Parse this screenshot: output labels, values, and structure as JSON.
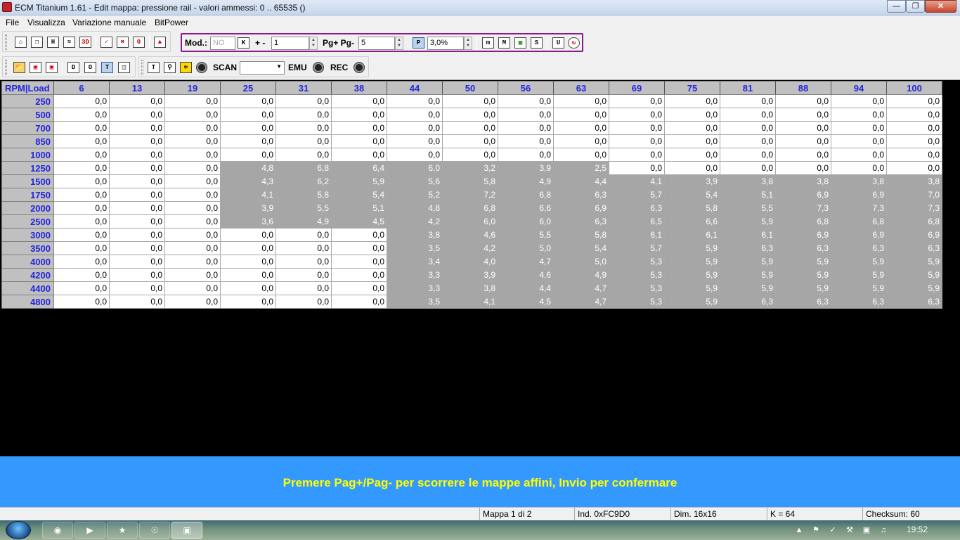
{
  "window": {
    "title": "ECM Titanium 1.61 - Edit mappa: pressione rail - valori ammessi: 0 .. 65535 ()"
  },
  "menu": [
    "File",
    "Visualizza",
    "Variazione manuale",
    "BitPower"
  ],
  "toolbar": {
    "mod_label": "Mod.:",
    "mod_value": "NO",
    "k_button": "K",
    "plusminus_label": "+ -",
    "step_value": "1",
    "pg_label": "Pg+ Pg-",
    "pg_value": "5",
    "p_button": "P",
    "percent_value": "3,0%",
    "scan_label": "SCAN",
    "emu_label": "EMU",
    "rec_label": "REC"
  },
  "table": {
    "corner": "RPM|Load",
    "columns": [
      "6",
      "13",
      "19",
      "25",
      "31",
      "38",
      "44",
      "50",
      "56",
      "63",
      "69",
      "75",
      "81",
      "88",
      "94",
      "100"
    ],
    "rows": [
      {
        "rpm": "250",
        "values": [
          "0,0",
          "0,0",
          "0,0",
          "0,0",
          "0,0",
          "0,0",
          "0,0",
          "0,0",
          "0,0",
          "0,0",
          "0,0",
          "0,0",
          "0,0",
          "0,0",
          "0,0",
          "0,0"
        ]
      },
      {
        "rpm": "500",
        "values": [
          "0,0",
          "0,0",
          "0,0",
          "0,0",
          "0,0",
          "0,0",
          "0,0",
          "0,0",
          "0,0",
          "0,0",
          "0,0",
          "0,0",
          "0,0",
          "0,0",
          "0,0",
          "0,0"
        ]
      },
      {
        "rpm": "700",
        "values": [
          "0,0",
          "0,0",
          "0,0",
          "0,0",
          "0,0",
          "0,0",
          "0,0",
          "0,0",
          "0,0",
          "0,0",
          "0,0",
          "0,0",
          "0,0",
          "0,0",
          "0,0",
          "0,0"
        ]
      },
      {
        "rpm": "850",
        "values": [
          "0,0",
          "0,0",
          "0,0",
          "0,0",
          "0,0",
          "0,0",
          "0,0",
          "0,0",
          "0,0",
          "0,0",
          "0,0",
          "0,0",
          "0,0",
          "0,0",
          "0,0",
          "0,0"
        ]
      },
      {
        "rpm": "1000",
        "values": [
          "0,0",
          "0,0",
          "0,0",
          "0,0",
          "0,0",
          "0,0",
          "0,0",
          "0,0",
          "0,0",
          "0,0",
          "0,0",
          "0,0",
          "0,0",
          "0,0",
          "0,0",
          "0,0"
        ]
      },
      {
        "rpm": "1250",
        "values": [
          "0,0",
          "0,0",
          "0,0",
          "4,8",
          "6,8",
          "6,4",
          "6,0",
          "3,2",
          "3,9",
          "2,5",
          "0,0",
          "0,0",
          "0,0",
          "0,0",
          "0,0",
          "0,0"
        ]
      },
      {
        "rpm": "1500",
        "values": [
          "0,0",
          "0,0",
          "0,0",
          "4,3",
          "6,2",
          "5,9",
          "5,6",
          "5,8",
          "4,9",
          "4,4",
          "4,1",
          "3,9",
          "3,8",
          "3,8",
          "3,8",
          "3,8"
        ]
      },
      {
        "rpm": "1750",
        "values": [
          "0,0",
          "0,0",
          "0,0",
          "4,1",
          "5,8",
          "5,4",
          "5,2",
          "7,2",
          "6,8",
          "6,3",
          "5,7",
          "5,4",
          "5,1",
          "6,9",
          "6,9",
          "7,0"
        ]
      },
      {
        "rpm": "2000",
        "values": [
          "0,0",
          "0,0",
          "0,0",
          "3,9",
          "5,5",
          "5,1",
          "4,8",
          "6,8",
          "6,6",
          "6,9",
          "6,3",
          "5,8",
          "5,5",
          "7,3",
          "7,3",
          "7,3"
        ]
      },
      {
        "rpm": "2500",
        "values": [
          "0,0",
          "0,0",
          "0,0",
          "3,6",
          "4,9",
          "4,5",
          "4,2",
          "6,0",
          "6,0",
          "6,3",
          "6,5",
          "6,6",
          "5,9",
          "6,8",
          "6,8",
          "6,8"
        ]
      },
      {
        "rpm": "3000",
        "values": [
          "0,0",
          "0,0",
          "0,0",
          "0,0",
          "0,0",
          "0,0",
          "3,8",
          "4,6",
          "5,5",
          "5,8",
          "6,1",
          "6,1",
          "6,1",
          "6,9",
          "6,9",
          "6,9"
        ]
      },
      {
        "rpm": "3500",
        "values": [
          "0,0",
          "0,0",
          "0,0",
          "0,0",
          "0,0",
          "0,0",
          "3,5",
          "4,2",
          "5,0",
          "5,4",
          "5,7",
          "5,9",
          "6,3",
          "6,3",
          "6,3",
          "6,3"
        ]
      },
      {
        "rpm": "4000",
        "values": [
          "0,0",
          "0,0",
          "0,0",
          "0,0",
          "0,0",
          "0,0",
          "3,4",
          "4,0",
          "4,7",
          "5,0",
          "5,3",
          "5,9",
          "5,9",
          "5,9",
          "5,9",
          "5,9"
        ]
      },
      {
        "rpm": "4200",
        "values": [
          "0,0",
          "0,0",
          "0,0",
          "0,0",
          "0,0",
          "0,0",
          "3,3",
          "3,9",
          "4,6",
          "4,9",
          "5,3",
          "5,9",
          "5,9",
          "5,9",
          "5,9",
          "5,9"
        ]
      },
      {
        "rpm": "4400",
        "values": [
          "0,0",
          "0,0",
          "0,0",
          "0,0",
          "0,0",
          "0,0",
          "3,3",
          "3,8",
          "4,4",
          "4,7",
          "5,3",
          "5,9",
          "5,9",
          "5,9",
          "5,9",
          "5,9"
        ]
      },
      {
        "rpm": "4800",
        "values": [
          "0,0",
          "0,0",
          "0,0",
          "0,0",
          "0,0",
          "0,0",
          "3,5",
          "4,1",
          "4,5",
          "4,7",
          "5,3",
          "5,9",
          "6,3",
          "6,3",
          "6,3",
          "6,3"
        ]
      }
    ],
    "colors": {
      "modified_cell": "#a6a6a6",
      "header_text": "#2323e0",
      "header_bg": "#c0c0c0"
    }
  },
  "hint": "Premere Pag+/Pag- per scorrere le mappe affini, Invio per confermare",
  "status": {
    "mappa": "Mappa 1 di 2",
    "ind": "Ind. 0xFC9D0",
    "dim": "Dim. 16x16",
    "k": "K = 64",
    "checksum": "Checksum: 60"
  },
  "taskbar": {
    "clock": "19:52"
  }
}
